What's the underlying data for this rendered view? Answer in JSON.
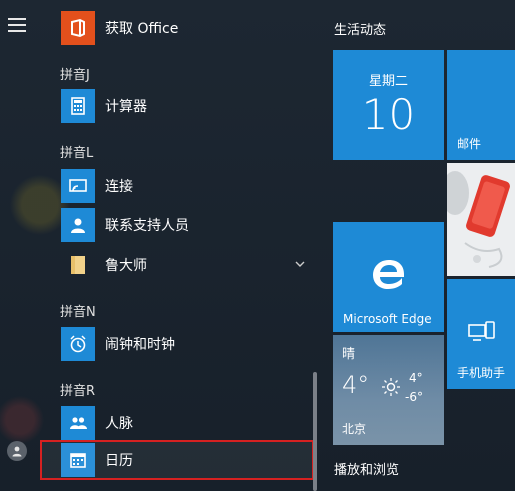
{
  "app_list": {
    "groups": [
      {
        "header": "拼音J",
        "items": [
          {
            "label": "计算器",
            "icon": "calculator-icon"
          }
        ]
      },
      {
        "header": "拼音L",
        "items": [
          {
            "label": "连接",
            "icon": "connect-icon"
          },
          {
            "label": "联系支持人员",
            "icon": "support-person-icon"
          },
          {
            "label": "鲁大师",
            "icon": "folder-icon"
          }
        ]
      },
      {
        "header": "拼音N",
        "items": [
          {
            "label": "闹钟和时钟",
            "icon": "alarm-clock-icon"
          }
        ]
      },
      {
        "header": "拼音R",
        "items": [
          {
            "label": "人脉",
            "icon": "people-icon"
          },
          {
            "label": "日历",
            "icon": "calendar-icon"
          }
        ]
      }
    ],
    "top_item": {
      "label": "获取 Office",
      "icon": "office-icon"
    }
  },
  "tiles": {
    "section_header": "生活动态",
    "calendar": {
      "weekday": "星期二",
      "day": "10"
    },
    "mail": {
      "label": "邮件"
    },
    "edge": {
      "label": "Microsoft Edge"
    },
    "weather": {
      "condition": "晴",
      "temp_now": "4°",
      "high": "4°",
      "low": "-6°",
      "city": "北京"
    },
    "phone": {
      "label": "手机助手"
    },
    "play_header": "播放和浏览"
  },
  "colors": {
    "tile_blue": "#1e8ad6",
    "office_orange": "#e3501c",
    "highlight_red": "#d62121",
    "folder_yellow": "#f2d28a"
  }
}
